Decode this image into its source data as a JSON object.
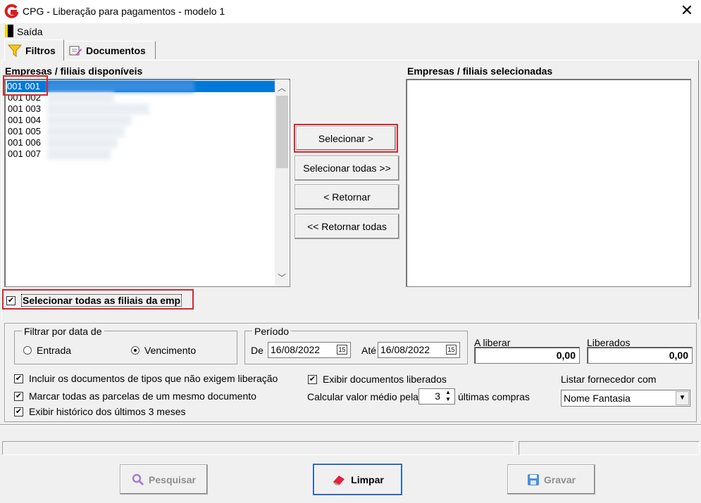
{
  "window": {
    "title": "CPG - Liberação para pagamentos - modelo 1"
  },
  "menu": {
    "exit": "Saída"
  },
  "tabs": [
    {
      "label": "Filtros"
    },
    {
      "label": "Documentos"
    }
  ],
  "available": {
    "label": "Empresas / filiais disponíveis",
    "items": [
      {
        "code": "001 001"
      },
      {
        "code": "001 002"
      },
      {
        "code": "001 003"
      },
      {
        "code": "001 004"
      },
      {
        "code": "001 005"
      },
      {
        "code": "001 006"
      },
      {
        "code": "001 007"
      }
    ]
  },
  "selected": {
    "label": "Empresas / filiais selecionadas"
  },
  "buttons": {
    "selecionar": "Selecionar >",
    "selecionar_todas": "Selecionar todas >>",
    "retornar": "< Retornar",
    "retornar_todas": "<< Retornar todas",
    "pesquisar": "Pesquisar",
    "limpar": "Limpar",
    "gravar": "Gravar"
  },
  "select_all_filiais": {
    "label": "Selecionar todas as filiais da emp",
    "checked": true
  },
  "filter_by_date": {
    "legend": "Filtrar por data de",
    "options": [
      "Entrada",
      "Vencimento"
    ],
    "selected": "Vencimento"
  },
  "periodo": {
    "legend": "Período",
    "de_label": "De",
    "de": "16/08/2022",
    "ate_label": "Até",
    "ate": "16/08/2022",
    "cal_icon_text": "15"
  },
  "totals": {
    "a_liberar_label": "A liberar",
    "a_liberar": "0,00",
    "liberados_label": "Liberados",
    "liberados": "0,00"
  },
  "options": {
    "incluir": "Incluir os documentos de tipos que não exigem liberação",
    "marcar": "Marcar todas as parcelas de um mesmo documento",
    "historico": "Exibir histórico dos últimos 3 meses",
    "exibir_liberados": "Exibir documentos liberados"
  },
  "average": {
    "prefix": "Calcular valor médio pelas",
    "value": "3",
    "suffix": "últimas compras"
  },
  "fornecedor": {
    "label": "Listar fornecedor com",
    "value": "Nome Fantasia"
  },
  "icons": {
    "logo": "app-logo-icon",
    "filter": "funnel-icon",
    "documents": "document-pen-icon",
    "search": "magnifier-icon",
    "eraser": "eraser-icon",
    "save": "floppy-disk-icon"
  },
  "colors": {
    "selection": "#0078d7",
    "annotation": "#d6272d"
  }
}
